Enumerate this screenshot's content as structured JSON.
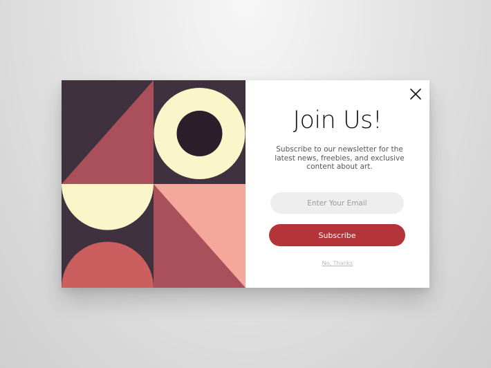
{
  "artwork": {
    "colors": {
      "plum": "#40313f",
      "rose": "#a9505a",
      "cream": "#fbf6c9",
      "dark_plum": "#2a1f2b",
      "salmon": "#f6a79c",
      "coral": "#cb5f5f"
    },
    "tiles": [
      "triangle",
      "ring",
      "half-circle",
      "diagonal-split",
      "half-circle"
    ]
  },
  "close_icon": "close-icon",
  "title": "Join Us!",
  "description": "Subscribe to our newsletter for the latest news, freebies, and exclusive content about art.",
  "email": {
    "placeholder": "Enter Your Email",
    "value": ""
  },
  "subscribe": {
    "label": "Subscribe",
    "color": "#b4343a"
  },
  "decline_label": "No, Thanks"
}
